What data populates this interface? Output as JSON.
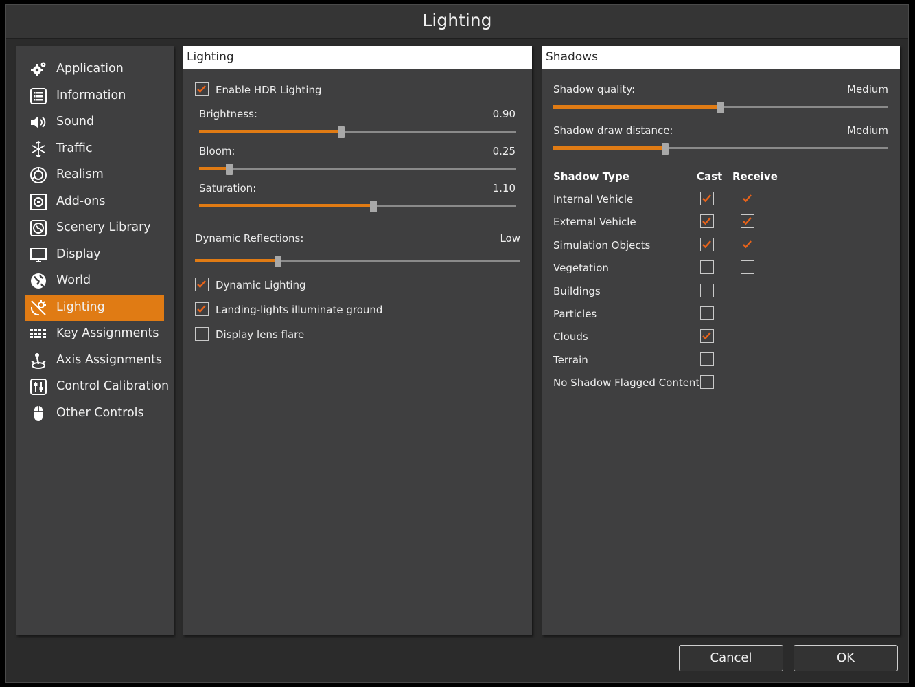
{
  "window": {
    "title": "Lighting"
  },
  "sidebar": {
    "items": [
      {
        "label": "Application",
        "icon": "gear-icon"
      },
      {
        "label": "Information",
        "icon": "list-icon"
      },
      {
        "label": "Sound",
        "icon": "speaker-icon"
      },
      {
        "label": "Traffic",
        "icon": "traffic-icon"
      },
      {
        "label": "Realism",
        "icon": "realism-icon"
      },
      {
        "label": "Add-ons",
        "icon": "addons-icon"
      },
      {
        "label": "Scenery Library",
        "icon": "scenery-icon"
      },
      {
        "label": "Display",
        "icon": "monitor-icon"
      },
      {
        "label": "World",
        "icon": "globe-icon"
      },
      {
        "label": "Lighting",
        "icon": "lighting-icon",
        "active": true
      },
      {
        "label": "Key Assignments",
        "icon": "keyboard-icon"
      },
      {
        "label": "Axis Assignments",
        "icon": "joystick-icon"
      },
      {
        "label": "Control Calibration",
        "icon": "calibration-icon"
      },
      {
        "label": "Other Controls",
        "icon": "mouse-icon"
      }
    ]
  },
  "lighting": {
    "header": "Lighting",
    "enable_hdr": {
      "label": "Enable HDR Lighting",
      "checked": true
    },
    "brightness": {
      "label": "Brightness:",
      "value": "0.90",
      "fraction": 0.45
    },
    "bloom": {
      "label": "Bloom:",
      "value": "0.25",
      "fraction": 0.095
    },
    "saturation": {
      "label": "Saturation:",
      "value": "1.10",
      "fraction": 0.55
    },
    "dynamic_reflections": {
      "label": "Dynamic Reflections:",
      "value": "Low",
      "fraction": 0.255
    },
    "dynamic_lighting": {
      "label": "Dynamic Lighting",
      "checked": true
    },
    "landing_lights": {
      "label": "Landing-lights illuminate ground",
      "checked": true
    },
    "lens_flare": {
      "label": "Display lens flare",
      "checked": false
    }
  },
  "shadows": {
    "header": "Shadows",
    "quality": {
      "label": "Shadow quality:",
      "value": "Medium",
      "fraction": 0.5
    },
    "draw_distance": {
      "label": "Shadow draw distance:",
      "value": "Medium",
      "fraction": 0.335
    },
    "table": {
      "col_type": "Shadow Type",
      "col_cast": "Cast",
      "col_receive": "Receive",
      "rows": [
        {
          "label": "Internal Vehicle",
          "cast": true,
          "receive": true
        },
        {
          "label": "External Vehicle",
          "cast": true,
          "receive": true
        },
        {
          "label": "Simulation Objects",
          "cast": true,
          "receive": true
        },
        {
          "label": "Vegetation",
          "cast": false,
          "receive": false
        },
        {
          "label": "Buildings",
          "cast": false,
          "receive": false
        },
        {
          "label": "Particles",
          "cast": false,
          "receive": null
        },
        {
          "label": "Clouds",
          "cast": true,
          "receive": null
        },
        {
          "label": "Terrain",
          "cast": false,
          "receive": null
        },
        {
          "label": "No Shadow Flagged Content",
          "cast": false,
          "receive": null
        }
      ]
    }
  },
  "footer": {
    "cancel_label": "Cancel",
    "ok_label": "OK"
  },
  "colors": {
    "accent": "#e07b14",
    "panel": "#3f3f40",
    "background": "#2b2b2b",
    "check": "#e8631a"
  }
}
